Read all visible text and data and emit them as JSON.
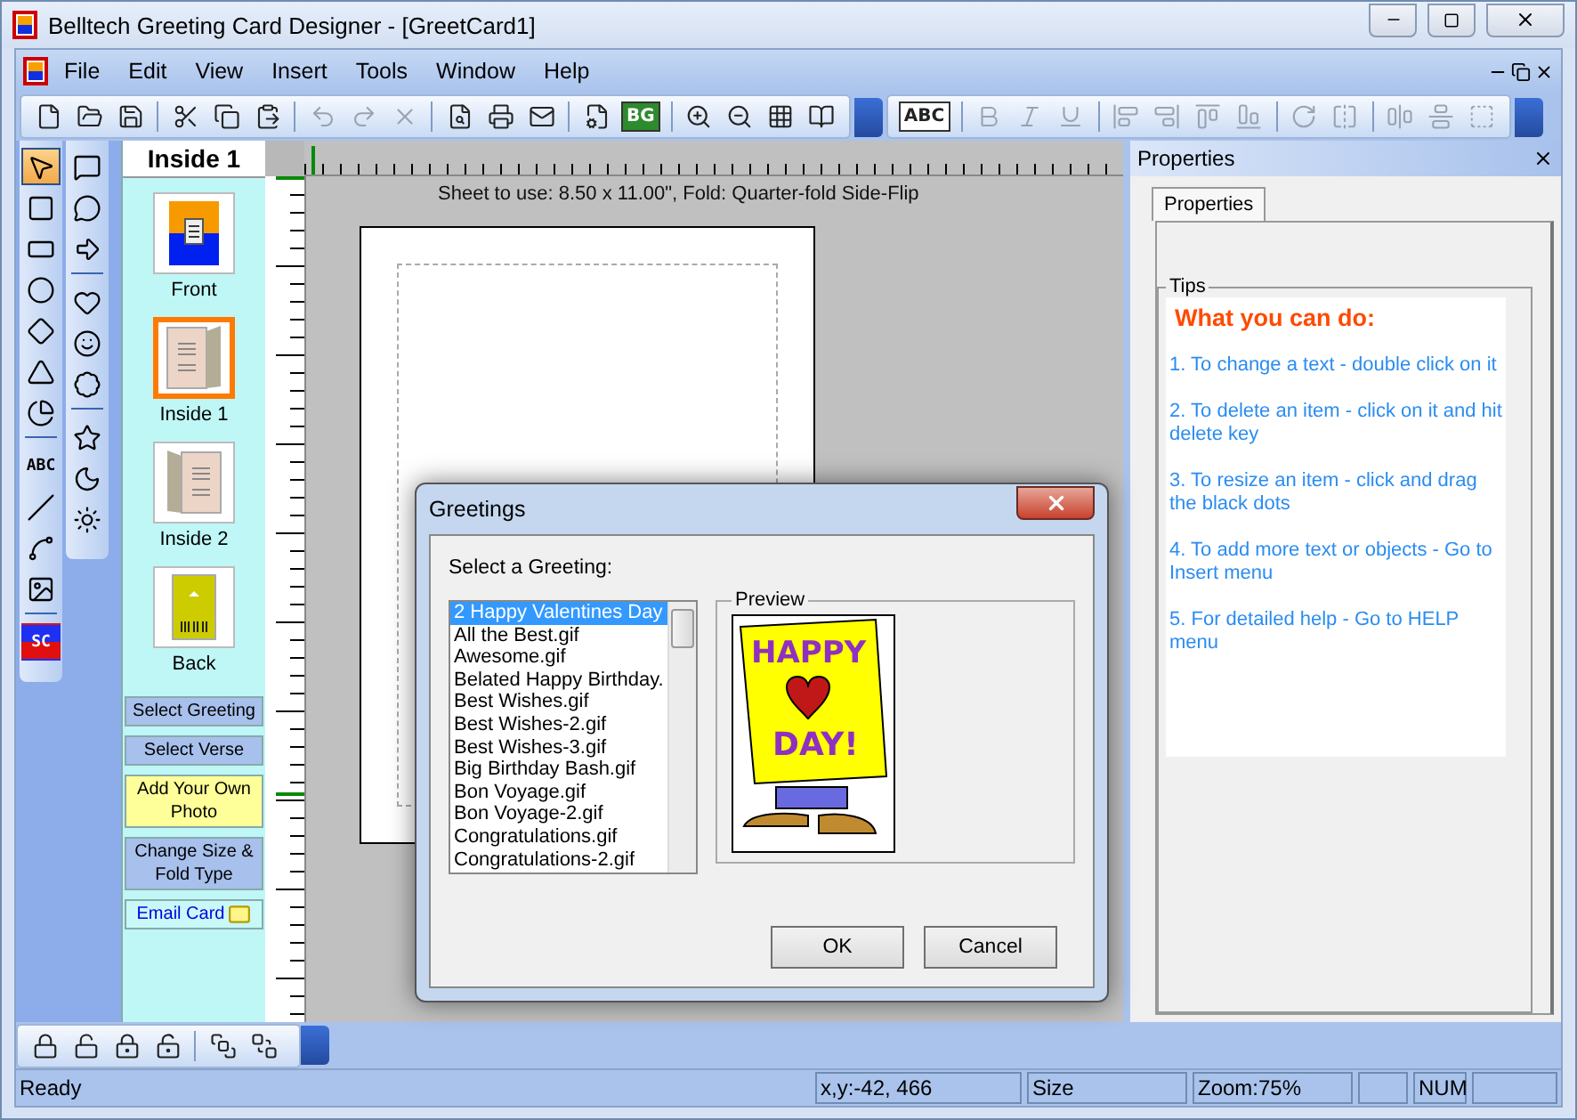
{
  "window": {
    "title": "Belltech Greeting Card Designer  - [GreetCard1]"
  },
  "menu": [
    "File",
    "Edit",
    "View",
    "Insert",
    "Tools",
    "Window",
    "Help"
  ],
  "toolbars": [
    [
      {
        "kind": "new",
        "disabled": false
      },
      {
        "kind": "open",
        "disabled": false
      },
      {
        "kind": "save",
        "disabled": false
      },
      {
        "kind": "sep"
      },
      {
        "kind": "cut",
        "disabled": false
      },
      {
        "kind": "copy",
        "disabled": false
      },
      {
        "kind": "paste",
        "disabled": false
      },
      {
        "kind": "sep"
      },
      {
        "kind": "undo",
        "disabled": true
      },
      {
        "kind": "redo",
        "disabled": true
      },
      {
        "kind": "delete",
        "disabled": true
      },
      {
        "kind": "sep"
      },
      {
        "kind": "preview",
        "disabled": false
      },
      {
        "kind": "print",
        "disabled": false
      },
      {
        "kind": "mail",
        "disabled": false
      },
      {
        "kind": "sep"
      },
      {
        "kind": "properties",
        "disabled": false
      },
      {
        "kind": "background",
        "label": "BG",
        "disabled": false
      },
      {
        "kind": "sep"
      },
      {
        "kind": "zoom_in",
        "disabled": false
      },
      {
        "kind": "zoom_out",
        "disabled": false
      },
      {
        "kind": "grid",
        "disabled": false
      },
      {
        "kind": "book",
        "disabled": false
      }
    ],
    [
      {
        "kind": "spell",
        "label": "ABC",
        "disabled": false
      },
      {
        "kind": "sep"
      },
      {
        "kind": "bold",
        "disabled": true
      },
      {
        "kind": "italic",
        "disabled": true
      },
      {
        "kind": "underline",
        "disabled": true
      },
      {
        "kind": "sep"
      },
      {
        "kind": "align_left",
        "disabled": true
      },
      {
        "kind": "align_right",
        "disabled": true
      },
      {
        "kind": "align_top",
        "disabled": true
      },
      {
        "kind": "align_bottom",
        "disabled": true
      },
      {
        "kind": "sep"
      },
      {
        "kind": "rotate",
        "disabled": true
      },
      {
        "kind": "flip",
        "disabled": true
      },
      {
        "kind": "sep"
      },
      {
        "kind": "center_h",
        "disabled": true
      },
      {
        "kind": "center_v",
        "disabled": true
      },
      {
        "kind": "center_both",
        "disabled": true
      }
    ]
  ],
  "palettes": [
    [
      {
        "kind": "pointer",
        "selected": true
      },
      {
        "kind": "rectangle",
        "selected": false
      },
      {
        "kind": "rounded",
        "selected": false
      },
      {
        "kind": "ellipse",
        "selected": false
      },
      {
        "kind": "diamond",
        "selected": false
      },
      {
        "kind": "triangle",
        "selected": false
      },
      {
        "kind": "pie",
        "selected": false
      },
      {
        "kind": "sep"
      },
      {
        "kind": "text",
        "label": "ABC",
        "selected": false
      },
      {
        "kind": "line",
        "selected": false
      },
      {
        "kind": "curve",
        "selected": false
      },
      {
        "kind": "picture",
        "selected": false
      },
      {
        "kind": "sep"
      },
      {
        "kind": "shortcut",
        "label": "SC",
        "selected": false
      }
    ],
    [
      {
        "kind": "callout",
        "selected": false
      },
      {
        "kind": "callout_round",
        "selected": false
      },
      {
        "kind": "arrow",
        "selected": false
      },
      {
        "kind": "sep"
      },
      {
        "kind": "heart",
        "selected": false
      },
      {
        "kind": "smiley",
        "selected": false
      },
      {
        "kind": "burst",
        "selected": false
      },
      {
        "kind": "sep"
      },
      {
        "kind": "star",
        "selected": false
      },
      {
        "kind": "moon",
        "selected": false
      },
      {
        "kind": "sun",
        "selected": false
      }
    ]
  ],
  "pages": {
    "header": "Inside 1",
    "items": [
      {
        "label": "Front",
        "kind": "front",
        "selected": false
      },
      {
        "label": "Inside 1",
        "kind": "inside_right",
        "selected": true
      },
      {
        "label": "Inside 2",
        "kind": "inside_left",
        "selected": false
      },
      {
        "label": "Back",
        "kind": "back",
        "selected": false
      }
    ]
  },
  "actions": [
    {
      "label": "Select Greeting",
      "kind": "plain"
    },
    {
      "label": "Select Verse",
      "kind": "plain"
    },
    {
      "label": "Add Your Own Photo",
      "kind": "highlight"
    },
    {
      "label": "Change Size & Fold Type",
      "kind": "plain"
    },
    {
      "label": "Email Card",
      "kind": "email"
    }
  ],
  "canvas": {
    "sheet_info": "Sheet to use: 8.50 x 11.00\", Fold: Quarter-fold Side-Flip"
  },
  "properties": {
    "title": "Properties",
    "tab": "Properties",
    "group": "Tips",
    "heading": "What you can do:",
    "tips": [
      "1. To change a text - double click on it",
      "2. To delete an item - click on it and hit delete key",
      "3. To resize an item - click and drag the black dots",
      "4. To add more text or objects - Go to Insert menu",
      "5. For detailed help - Go to HELP menu"
    ]
  },
  "dialog": {
    "title": "Greetings",
    "prompt": "Select a Greeting:",
    "preview_label": "Preview",
    "preview_text": [
      "HAPPY",
      "DAY!"
    ],
    "items": [
      {
        "label": "2 Happy Valentines Day",
        "selected": true
      },
      {
        "label": "All the Best.gif",
        "selected": false
      },
      {
        "label": "Awesome.gif",
        "selected": false
      },
      {
        "label": "Belated Happy Birthday.",
        "selected": false
      },
      {
        "label": "Best Wishes.gif",
        "selected": false
      },
      {
        "label": "Best Wishes-2.gif",
        "selected": false
      },
      {
        "label": "Best Wishes-3.gif",
        "selected": false
      },
      {
        "label": "Big Birthday Bash.gif",
        "selected": false
      },
      {
        "label": "Bon Voyage.gif",
        "selected": false
      },
      {
        "label": "Bon Voyage-2.gif",
        "selected": false
      },
      {
        "label": "Congratulations.gif",
        "selected": false
      },
      {
        "label": "Congratulations-2.gif",
        "selected": false
      }
    ],
    "buttons": [
      "OK",
      "Cancel"
    ]
  },
  "bottom_toolbar": [
    {
      "kind": "lock"
    },
    {
      "kind": "unlock"
    },
    {
      "kind": "lock_all"
    },
    {
      "kind": "unlock_all"
    },
    {
      "kind": "sep"
    },
    {
      "kind": "bring_front"
    },
    {
      "kind": "send_back"
    }
  ],
  "status": {
    "message": "Ready",
    "panels": [
      "x,y:-42, 466",
      "Size",
      "Zoom:75%"
    ],
    "indicators": [
      "NUM"
    ]
  }
}
